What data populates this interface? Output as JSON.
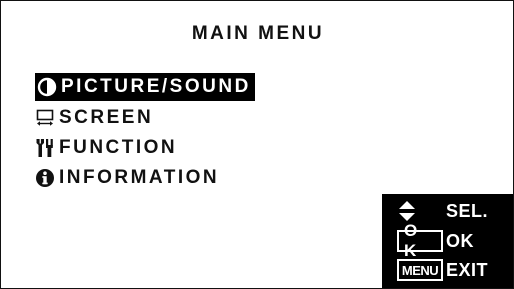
{
  "menu": {
    "title": "MAIN MENU",
    "items": [
      {
        "label": "PICTURE/SOUND",
        "icon": "half-circle-contrast-icon",
        "selected": true
      },
      {
        "label": "SCREEN",
        "icon": "screen-resize-icon",
        "selected": false
      },
      {
        "label": "FUNCTION",
        "icon": "tools-icon",
        "selected": false
      },
      {
        "label": "INFORMATION",
        "icon": "info-icon",
        "selected": false
      }
    ]
  },
  "keys": [
    {
      "key": "up-down-arrows-icon",
      "label": "SEL."
    },
    {
      "key": "O K",
      "label": "OK"
    },
    {
      "key": "MENU",
      "label": "EXIT"
    }
  ],
  "colors": {
    "background": "#ffffff",
    "text": "#111111",
    "highlight": "#000000",
    "highlight_text": "#ffffff"
  }
}
